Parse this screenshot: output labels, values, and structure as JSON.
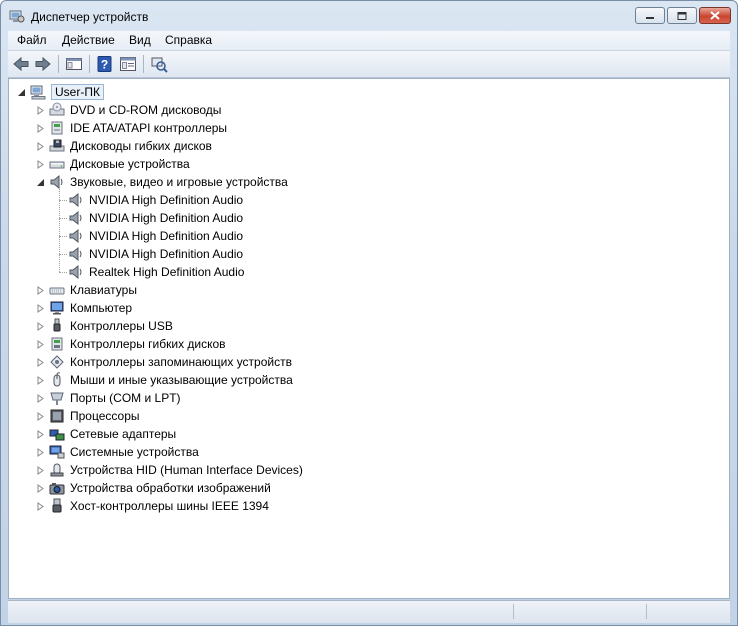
{
  "window": {
    "title": "Диспетчер устройств",
    "minimize_icon": "minimize-icon",
    "maximize_icon": "maximize-icon",
    "close_icon": "close-icon"
  },
  "menu": {
    "items": [
      {
        "label": "Файл"
      },
      {
        "label": "Действие"
      },
      {
        "label": "Вид"
      },
      {
        "label": "Справка"
      }
    ]
  },
  "toolbar": {
    "buttons": [
      "back-arrow-icon",
      "forward-arrow-icon",
      "console-tree-icon",
      "help-icon",
      "properties-icon",
      "scan-hardware-icon"
    ]
  },
  "tree": {
    "root": {
      "label": "User-ПК",
      "icon": "computer-icon",
      "expanded": true
    },
    "categories": [
      {
        "label": "DVD и CD-ROM дисководы",
        "icon": "dvd-drive-icon"
      },
      {
        "label": "IDE ATA/ATAPI контроллеры",
        "icon": "ide-controller-icon"
      },
      {
        "label": "Дисководы гибких дисков",
        "icon": "floppy-drive-icon"
      },
      {
        "label": "Дисковые устройства",
        "icon": "disk-drive-icon"
      },
      {
        "label": "Звуковые, видео и игровые устройства",
        "icon": "speaker-icon",
        "expanded": true,
        "children": [
          {
            "label": "NVIDIA High Definition Audio",
            "icon": "speaker-icon"
          },
          {
            "label": "NVIDIA High Definition Audio",
            "icon": "speaker-icon"
          },
          {
            "label": "NVIDIA High Definition Audio",
            "icon": "speaker-icon"
          },
          {
            "label": "NVIDIA High Definition Audio",
            "icon": "speaker-icon"
          },
          {
            "label": "Realtek High Definition Audio",
            "icon": "speaker-icon"
          }
        ]
      },
      {
        "label": "Клавиатуры",
        "icon": "keyboard-icon"
      },
      {
        "label": "Компьютер",
        "icon": "monitor-icon"
      },
      {
        "label": "Контроллеры USB",
        "icon": "usb-icon"
      },
      {
        "label": "Контроллеры гибких дисков",
        "icon": "floppy-controller-icon"
      },
      {
        "label": "Контроллеры запоминающих устройств",
        "icon": "storage-controller-icon"
      },
      {
        "label": "Мыши и иные указывающие устройства",
        "icon": "mouse-icon"
      },
      {
        "label": "Порты (COM и LPT)",
        "icon": "port-icon"
      },
      {
        "label": "Процессоры",
        "icon": "processor-icon"
      },
      {
        "label": "Сетевые адаптеры",
        "icon": "network-adapter-icon"
      },
      {
        "label": "Системные устройства",
        "icon": "system-device-icon"
      },
      {
        "label": "Устройства HID (Human Interface Devices)",
        "icon": "hid-icon"
      },
      {
        "label": "Устройства обработки изображений",
        "icon": "camera-icon"
      },
      {
        "label": "Хост-контроллеры шины IEEE 1394",
        "icon": "ieee1394-icon"
      }
    ]
  },
  "colors": {
    "title_gradient": "#c9d8ea",
    "close_button": "#c9452f"
  }
}
